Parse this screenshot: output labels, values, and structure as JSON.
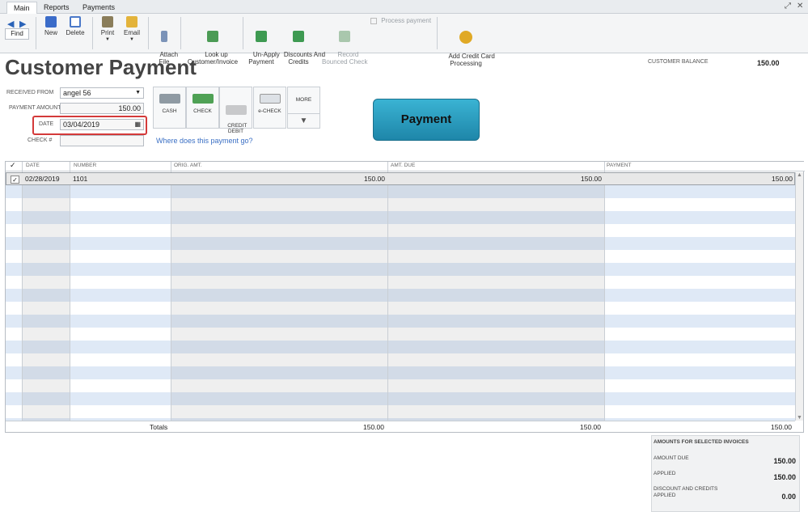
{
  "tabs": [
    "Main",
    "Reports",
    "Payments"
  ],
  "window_controls": {
    "restore": "⤢",
    "close": "✕"
  },
  "toolbar": {
    "find": "Find",
    "new": "New",
    "delete": "Delete",
    "print": "Print",
    "email": "Email",
    "attach_file": "Attach\nFile",
    "look_up": "Look up\nCustomer/Invoice",
    "unapply": "Un-Apply\nPayment",
    "discounts": "Discounts And\nCredits",
    "record_bounced": "Record\nBounced Check",
    "process_payment": "Process payment",
    "add_cc": "Add Credit Card\nProcessing"
  },
  "page_title": "Customer Payment",
  "customer_balance": {
    "label": "CUSTOMER BALANCE",
    "value": "150.00"
  },
  "form": {
    "received_from_label": "RECEIVED FROM",
    "received_from_value": "angel 56",
    "payment_amount_label": "PAYMENT AMOUNT",
    "payment_amount_value": "150.00",
    "date_label": "DATE",
    "date_value": "03/04/2019",
    "check_label": "CHECK #",
    "check_value": ""
  },
  "payment_methods": [
    "CASH",
    "CHECK",
    "CREDIT\nDEBIT",
    "e-CHECK",
    "MORE"
  ],
  "where_link": "Where does this payment go?",
  "big_button": "Payment",
  "table": {
    "headers": [
      "DATE",
      "NUMBER",
      "ORIG. AMT.",
      "AMT. DUE",
      "PAYMENT"
    ],
    "rows": [
      {
        "date": "02/28/2019",
        "number": "1101",
        "orig": "150.00",
        "due": "150.00",
        "payment": "150.00"
      }
    ],
    "totals_label": "Totals",
    "totals": {
      "orig": "150.00",
      "due": "150.00",
      "payment": "150.00"
    }
  },
  "amounts": {
    "title": "AMOUNTS FOR SELECTED INVOICES",
    "amount_due_label": "AMOUNT DUE",
    "amount_due": "150.00",
    "applied_label": "APPLIED",
    "applied": "150.00",
    "discount_label": "DISCOUNT AND CREDITS\nAPPLIED",
    "discount": "0.00"
  }
}
